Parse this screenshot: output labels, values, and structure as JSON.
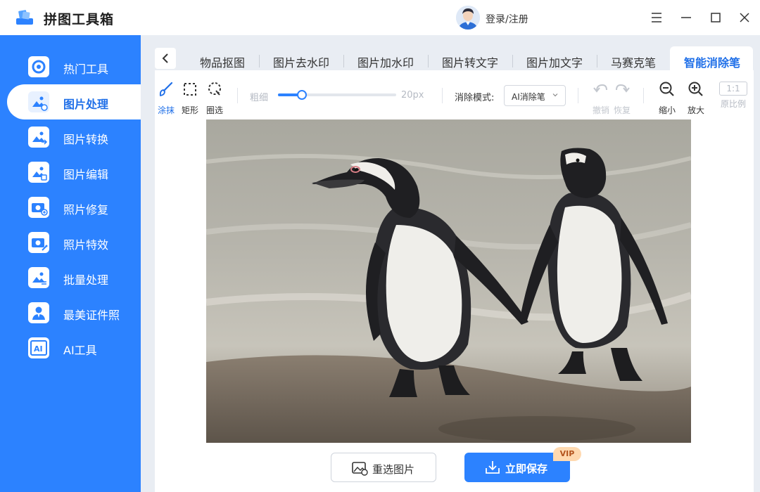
{
  "app": {
    "title": "拼图工具箱",
    "login_label": "登录/注册"
  },
  "window_controls": [
    "menu-icon",
    "minimize-icon",
    "maximize-icon",
    "close-icon"
  ],
  "colors": {
    "accent": "#2c82ff",
    "active_text": "#1f6fe8",
    "vip_badge": "#ffd9b0"
  },
  "sidebar": {
    "items": [
      {
        "label": "热门工具",
        "icon": "hot-tools-icon"
      },
      {
        "label": "图片处理",
        "icon": "image-process-icon",
        "active": true
      },
      {
        "label": "图片转换",
        "icon": "image-convert-icon"
      },
      {
        "label": "图片编辑",
        "icon": "image-edit-icon"
      },
      {
        "label": "照片修复",
        "icon": "photo-repair-icon"
      },
      {
        "label": "照片特效",
        "icon": "photo-effects-icon"
      },
      {
        "label": "批量处理",
        "icon": "batch-process-icon"
      },
      {
        "label": "最美证件照",
        "icon": "id-photo-icon"
      },
      {
        "label": "AI工具",
        "icon": "ai-tools-icon"
      }
    ]
  },
  "tabs": {
    "items": [
      "物品抠图",
      "图片去水印",
      "图片加水印",
      "图片转文字",
      "图片加文字",
      "马赛克笔",
      "智能消除笔"
    ],
    "active_index": 6
  },
  "toolbar": {
    "brush_label": "涂抹",
    "rect_label": "矩形",
    "lasso_label": "圈选",
    "size_label": "粗细",
    "size_value": "20px",
    "slider_fraction": 0.2,
    "mode_label": "消除模式:",
    "mode_value": "AI消除笔",
    "undo_label": "撤销",
    "redo_label": "恢复",
    "zoom_out_label": "缩小",
    "zoom_in_label": "放大",
    "ratio_box": "1:1",
    "ratio_label": "原比例"
  },
  "actions": {
    "reselect_label": "重选图片",
    "save_label": "立即保存",
    "vip_badge": "VIP"
  }
}
